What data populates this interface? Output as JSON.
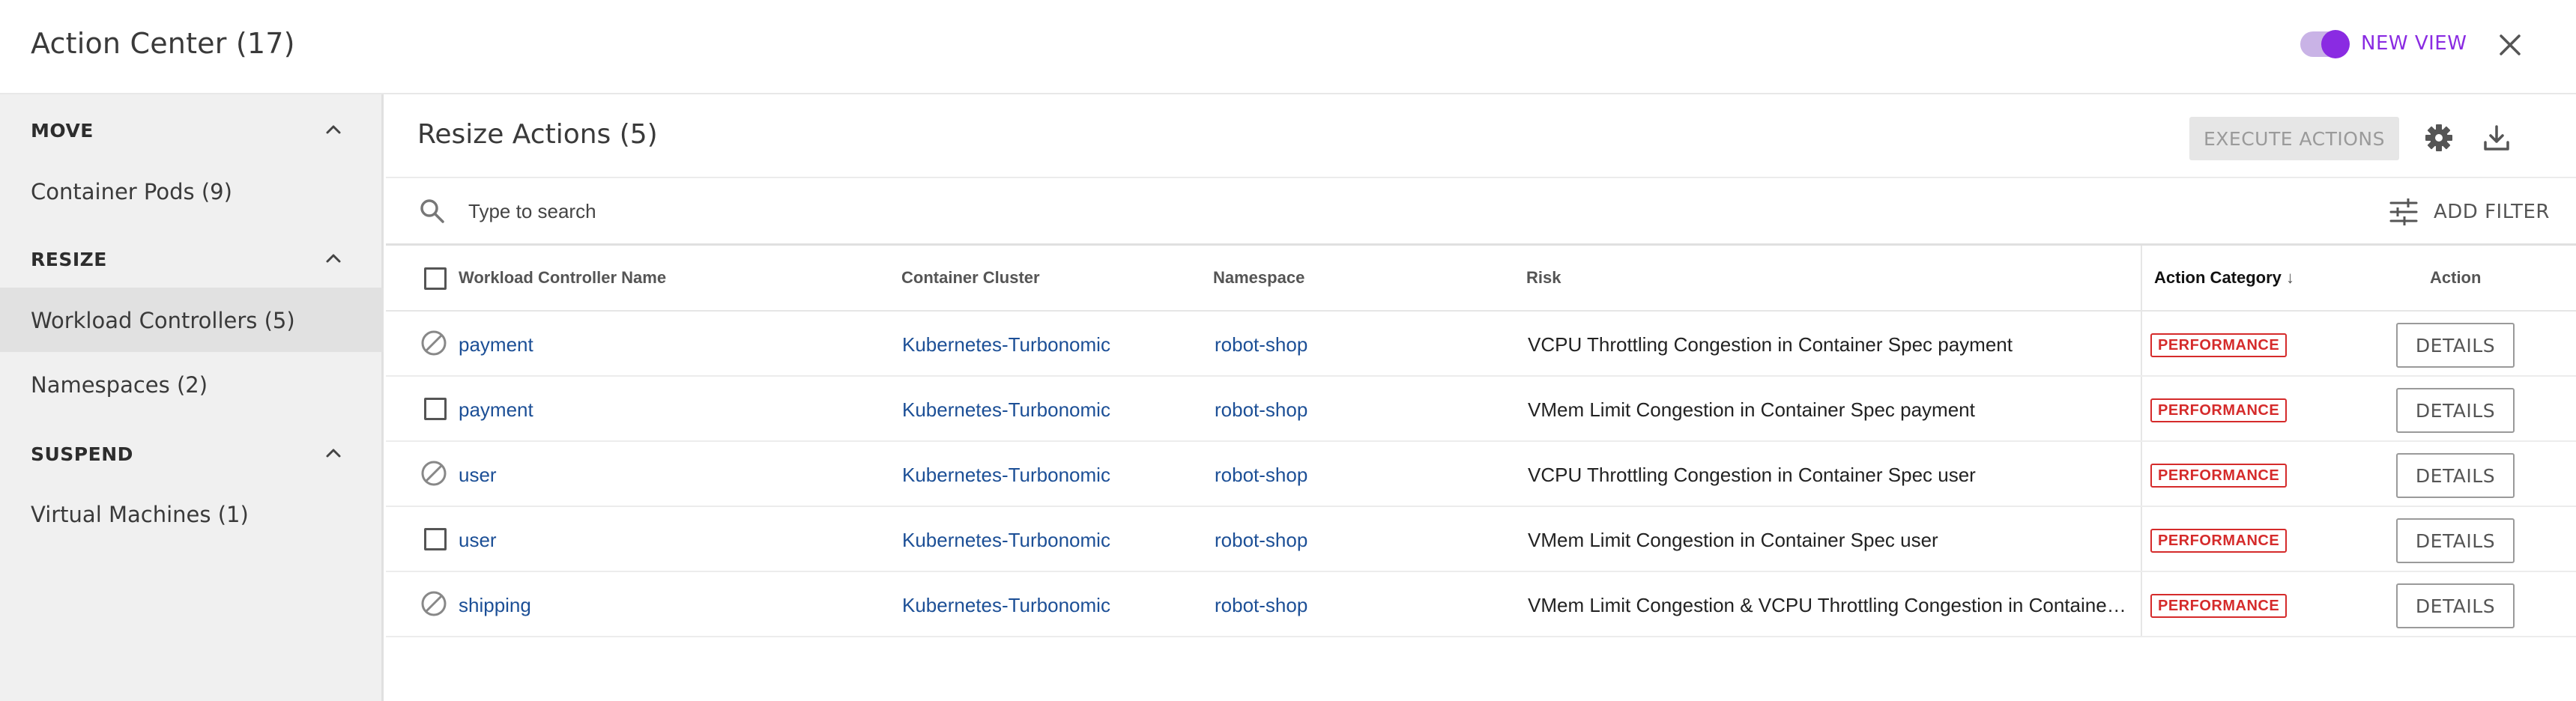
{
  "header": {
    "title": "Action Center (17)",
    "toggle_label": "NEW VIEW",
    "toggle_on": true,
    "accent_color": "#8a2be2"
  },
  "sidebar": {
    "sections": [
      {
        "label": "MOVE",
        "items": [
          {
            "label": "Container Pods (9)",
            "active": false
          }
        ]
      },
      {
        "label": "RESIZE",
        "items": [
          {
            "label": "Workload Controllers (5)",
            "active": true
          },
          {
            "label": "Namespaces (2)",
            "active": false
          }
        ]
      },
      {
        "label": "SUSPEND",
        "items": [
          {
            "label": "Virtual Machines (1)",
            "active": false
          }
        ]
      }
    ]
  },
  "main": {
    "title": "Resize Actions (5)",
    "execute_label": "EXECUTE ACTIONS",
    "search_placeholder": "Type to search",
    "add_filter_label": "ADD FILTER",
    "columns": {
      "name": "Workload Controller Name",
      "cluster": "Container Cluster",
      "namespace": "Namespace",
      "risk": "Risk",
      "category": "Action Category",
      "sort_indicator": "↓",
      "action": "Action"
    },
    "rows": [
      {
        "selectable": false,
        "name": "payment",
        "cluster": "Kubernetes-Turbonomic",
        "namespace": "robot-shop",
        "risk": "VCPU Throttling Congestion in Container Spec payment",
        "category": "PERFORMANCE",
        "action": "DETAILS"
      },
      {
        "selectable": true,
        "name": "payment",
        "cluster": "Kubernetes-Turbonomic",
        "namespace": "robot-shop",
        "risk": "VMem Limit Congestion in Container Spec payment",
        "category": "PERFORMANCE",
        "action": "DETAILS"
      },
      {
        "selectable": false,
        "name": "user",
        "cluster": "Kubernetes-Turbonomic",
        "namespace": "robot-shop",
        "risk": "VCPU Throttling Congestion in Container Spec user",
        "category": "PERFORMANCE",
        "action": "DETAILS"
      },
      {
        "selectable": true,
        "name": "user",
        "cluster": "Kubernetes-Turbonomic",
        "namespace": "robot-shop",
        "risk": "VMem Limit Congestion in Container Spec user",
        "category": "PERFORMANCE",
        "action": "DETAILS"
      },
      {
        "selectable": false,
        "name": "shipping",
        "cluster": "Kubernetes-Turbonomic",
        "namespace": "robot-shop",
        "risk": "VMem Limit Congestion & VCPU Throttling Congestion in Container Spec shipping",
        "category": "PERFORMANCE",
        "action": "DETAILS"
      }
    ]
  }
}
